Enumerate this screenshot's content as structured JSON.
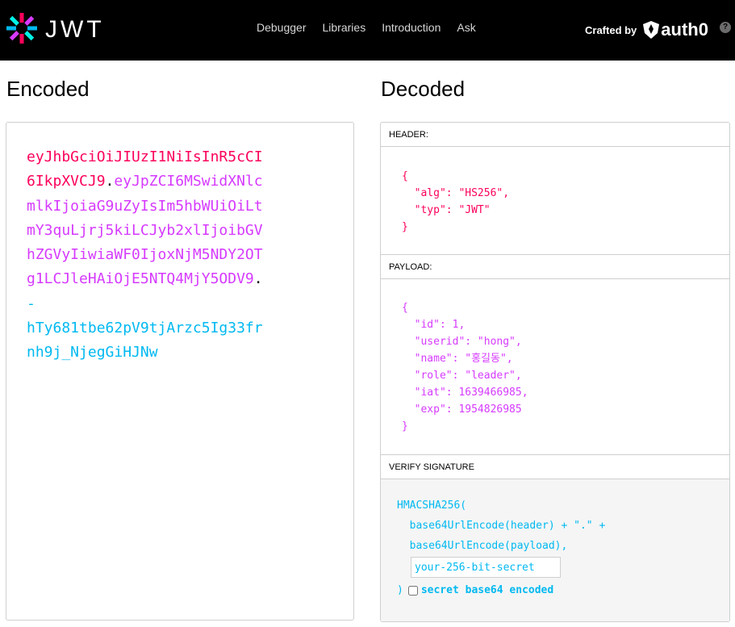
{
  "nav": {
    "logo_text": "JWT",
    "links": [
      "Debugger",
      "Libraries",
      "Introduction",
      "Ask"
    ],
    "crafted_by": "Crafted by",
    "brand": "auth0",
    "help": "?"
  },
  "encoded": {
    "title": "Encoded",
    "token_lines": [
      [
        {
          "t": "eyJhbGciOiJIUzI1NiIsInR5cCI",
          "c": "h"
        }
      ],
      [
        {
          "t": "6IkpXVCJ9",
          "c": "h"
        },
        {
          "t": ".",
          "c": "d"
        },
        {
          "t": "eyJpZCI6MSwidXNlc",
          "c": "p"
        }
      ],
      [
        {
          "t": "mlkIjoiaG9uZyIsIm5hbWUiOiLt",
          "c": "p"
        }
      ],
      [
        {
          "t": "mY3quLjrj5kiLCJyb2xlIjoibGV",
          "c": "p"
        }
      ],
      [
        {
          "t": "hZGVyIiwiaWF0IjoxNjM5NDY2OT",
          "c": "p"
        }
      ],
      [
        {
          "t": "g1LCJleHAiOjE5NTQ4MjY5ODV9",
          "c": "p"
        },
        {
          "t": ".",
          "c": "d"
        }
      ],
      [
        {
          "t": "-",
          "c": "s"
        }
      ],
      [
        {
          "t": "hTy681tbe62pV9tjArzc5Ig33fr",
          "c": "s"
        }
      ],
      [
        {
          "t": "nh9j_NjegGiHJNw",
          "c": "s"
        }
      ]
    ]
  },
  "decoded": {
    "title": "Decoded",
    "header_label": "HEADER:",
    "header_json": "{\n  \"alg\": \"HS256\",\n  \"typ\": \"JWT\"\n}",
    "payload_label": "PAYLOAD:",
    "payload_json": "{\n  \"id\": 1,\n  \"userid\": \"hong\",\n  \"name\": \"홍길동\",\n  \"role\": \"leader\",\n  \"iat\": 1639466985,\n  \"exp\": 1954826985\n}",
    "verify_label": "VERIFY SIGNATURE",
    "sig_lines": "HMACSHA256(\n  base64UrlEncode(header) + \".\" +\n  base64UrlEncode(payload),",
    "secret_placeholder": "your-256-bit-secret",
    "close_paren": ")",
    "base64_label": "secret base64 encoded"
  }
}
